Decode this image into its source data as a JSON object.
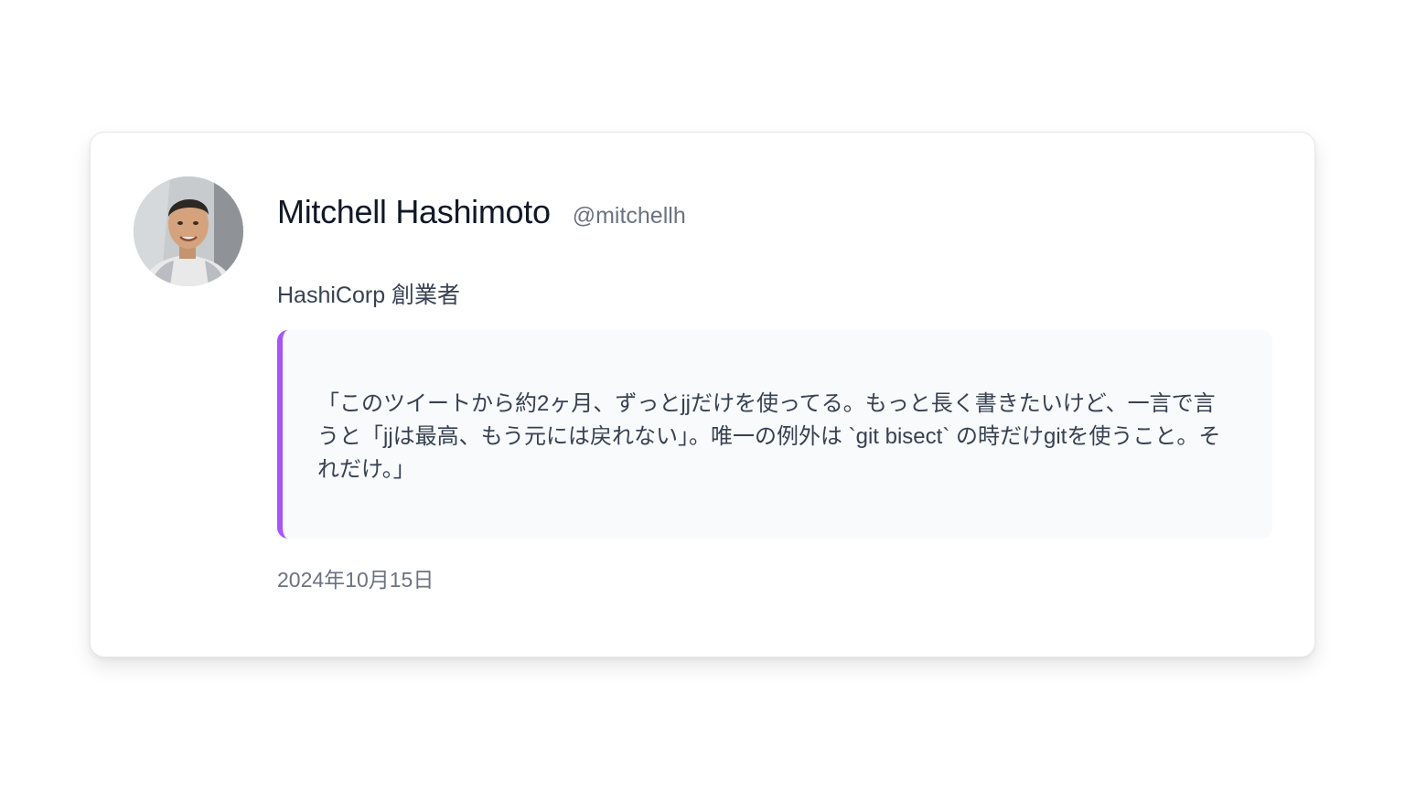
{
  "profile": {
    "name": "Mitchell Hashimoto",
    "handle": "@mitchellh",
    "bio": "HashiCorp 創業者",
    "avatar_icon": "person-photo"
  },
  "quote": {
    "text": "「このツイートから約2ヶ月、ずっとjjだけを使ってる。もっと長く書きたいけど、一言で言うと「jjは最高、もう元には戻れない」。唯一の例外は `git bisect` の時だけgitを使うこと。それだけ。」"
  },
  "date": "2024年10月15日",
  "colors": {
    "accent": "#a855f7",
    "name": "#111827",
    "muted": "#6b7280",
    "quote_bg": "#f8fafc"
  }
}
